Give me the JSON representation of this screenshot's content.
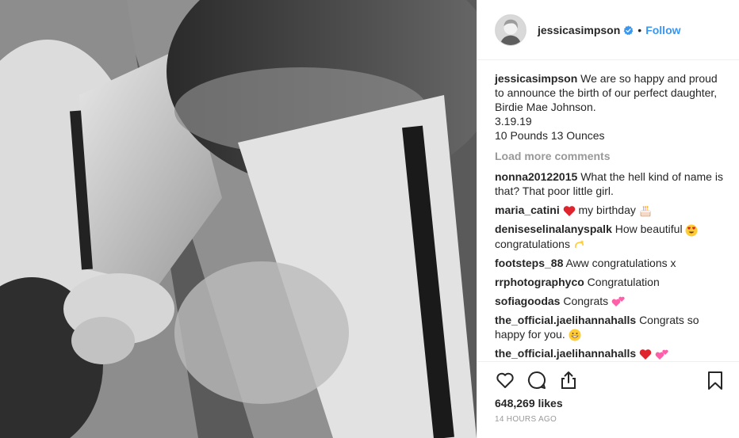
{
  "post": {
    "username": "jessicasimpson",
    "verified": true,
    "separator": "•",
    "follow_label": "Follow",
    "caption": {
      "username": "jessicasimpson",
      "lines": [
        "We are so happy and proud to announce the birth of our perfect daughter, Birdie Mae Johnson.",
        "3.19.19",
        "10 Pounds 13 Ounces"
      ]
    },
    "load_more_label": "Load more comments",
    "comments": [
      {
        "user": "nonna20122015",
        "text": "What the hell kind of name is that? That poor little girl.",
        "emojis": []
      },
      {
        "user": "maria_catini",
        "text_before": "",
        "emoji1": "red-heart",
        "text": "my birthday",
        "emojis": [
          "birthday-cake"
        ]
      },
      {
        "user": "deniseselinalanyspalk",
        "text": "How beautiful",
        "emojis": [
          "heart-eyes"
        ],
        "text2": "congratulations",
        "emojis2": [
          "dizzy"
        ]
      },
      {
        "user": "footsteps_88",
        "text": "Aww congratulations x",
        "emojis": []
      },
      {
        "user": "rrphotographyco",
        "text": "Congratulation",
        "emojis": []
      },
      {
        "user": "sofiagoodas",
        "text": "Congrats",
        "emojis": [
          "two-hearts"
        ]
      },
      {
        "user": "the_official.jaelihannahalls",
        "text": "Congrats so happy for you.",
        "emojis": [
          "grinning"
        ]
      },
      {
        "user": "the_official.jaelihannahalls",
        "text": "",
        "emojis": [
          "red-heart",
          "two-hearts"
        ]
      }
    ],
    "likes": "648,269 likes",
    "timestamp": "14 HOURS AGO"
  },
  "colors": {
    "link": "#3897f0",
    "muted": "#999999",
    "text": "#262626",
    "heart": "#ed4956"
  },
  "icons": [
    "heart-icon",
    "comment-icon",
    "share-icon",
    "bookmark-icon",
    "verified-badge-icon"
  ]
}
